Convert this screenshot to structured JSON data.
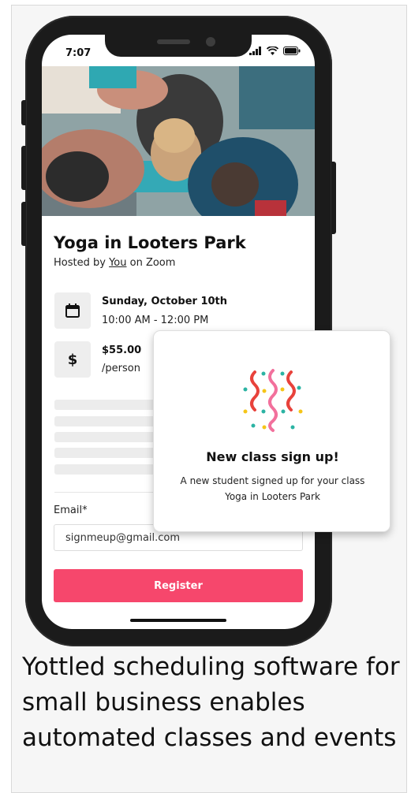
{
  "status_bar": {
    "time": "7:07"
  },
  "event": {
    "title": "Yoga in Looters Park",
    "hosted_prefix": "Hosted by ",
    "host": "You",
    "hosted_suffix": " on Zoom",
    "date": "Sunday, October 10th",
    "time_range": "10:00 AM - 12:00 PM",
    "price": "$55.00",
    "price_unit": "/person"
  },
  "icons": {
    "calendar": "calendar-icon",
    "dollar": "dollar-icon",
    "confetti": "confetti-icon",
    "signal": "signal-icon",
    "wifi": "wifi-icon",
    "battery": "battery-icon"
  },
  "form": {
    "email_label": "Email*",
    "email_value": "signmeup@gmail.com",
    "register_label": "Register"
  },
  "notification": {
    "title": "New class sign up!",
    "body": "A new student signed up for your class Yoga in Looters Park"
  },
  "caption": "Yottled scheduling software for small business enables automated classes and events",
  "colors": {
    "accent": "#f6476c",
    "confetti_red": "#e8423b",
    "confetti_pink": "#f2709c",
    "confetti_yellow": "#f5c518",
    "confetti_teal": "#2bb3a3"
  }
}
